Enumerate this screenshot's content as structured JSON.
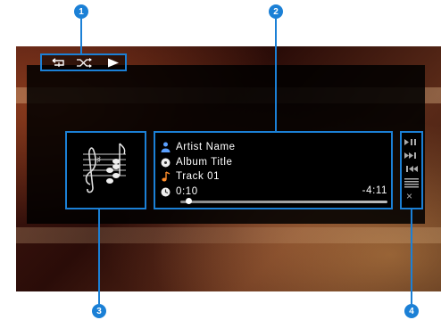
{
  "callouts": [
    "1",
    "2",
    "3",
    "4"
  ],
  "now_playing": {
    "artist": "Artist Name",
    "album": "Album Title",
    "track": "Track 01",
    "elapsed": "0:10",
    "remaining": "-4:11",
    "progress_fraction": 0.04
  },
  "status_bar": {
    "icons": [
      "repeat-icon",
      "shuffle-icon",
      "play-icon"
    ]
  },
  "controls": {
    "icons": [
      "play-pause-icon",
      "skip-forward-icon",
      "skip-back-icon",
      "list-menu-icon",
      "close-icon"
    ],
    "close_label": "×"
  },
  "colors": {
    "accent": "#1b80d6",
    "artist_icon": "#5aa0ff",
    "track_icon": "#ff8c2a"
  }
}
